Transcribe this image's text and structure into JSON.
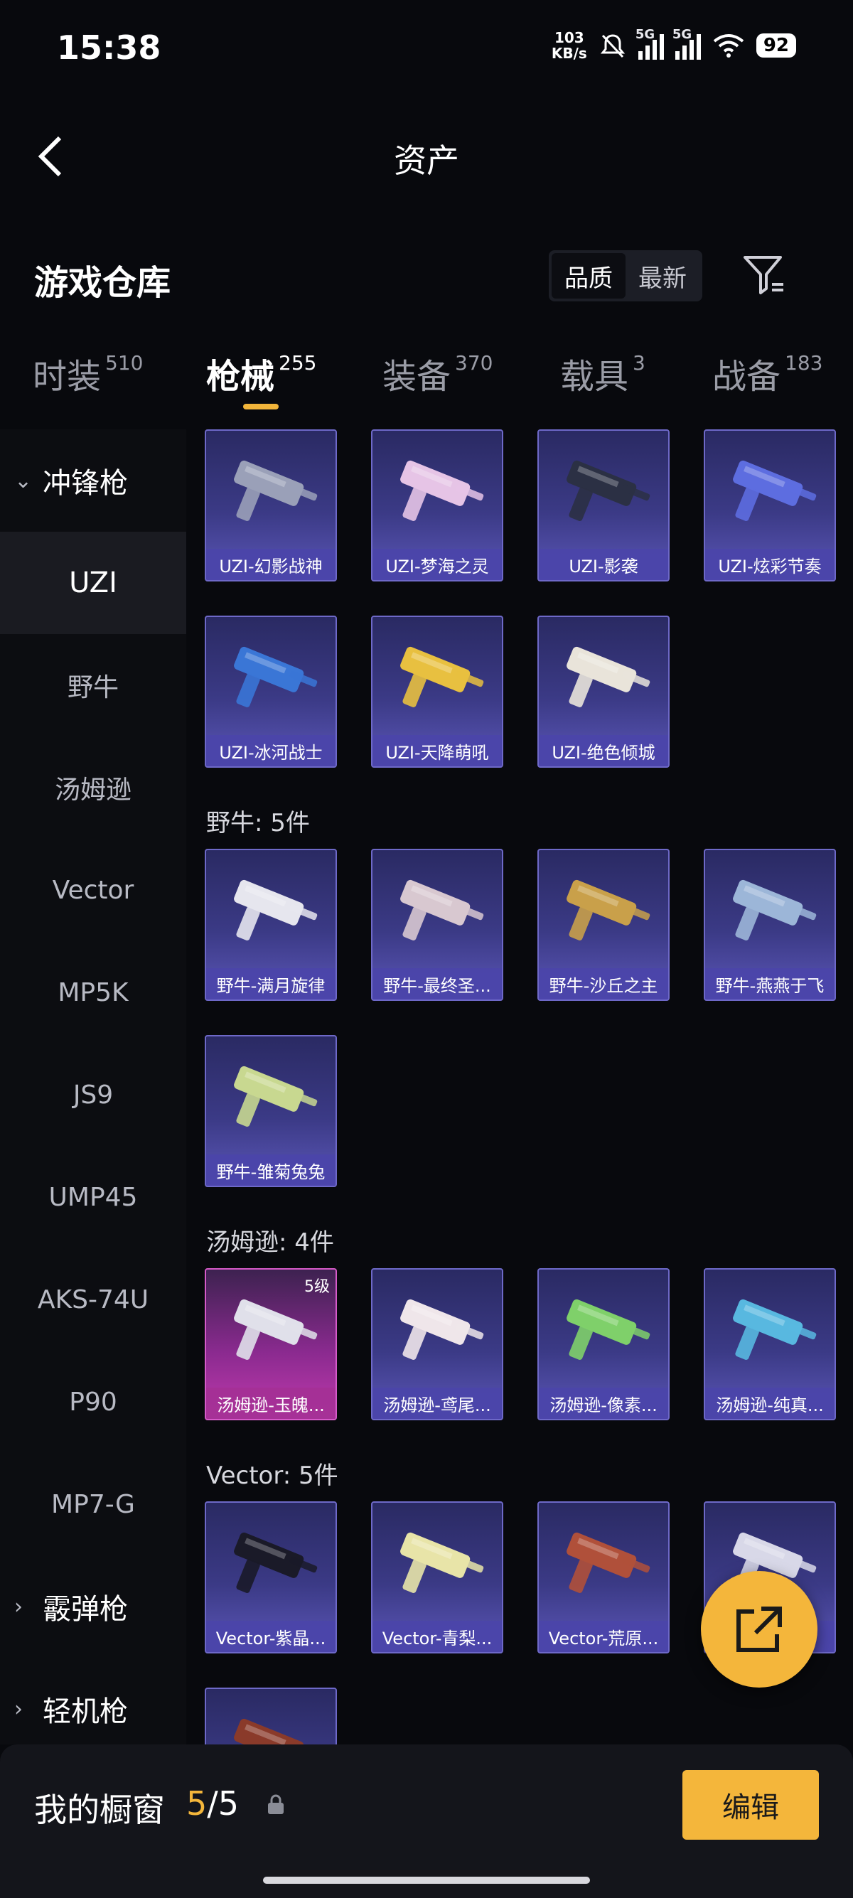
{
  "status": {
    "time": "15:38",
    "net_speed_value": "103",
    "net_speed_unit": "KB/s",
    "signal1_label": "5G",
    "signal2_label": "5G",
    "battery": "92"
  },
  "header": {
    "title": "资产"
  },
  "section": {
    "title": "游戏仓库",
    "sort_options": [
      "品质",
      "最新"
    ],
    "active_sort": "品质"
  },
  "tabs": [
    {
      "label": "时装",
      "count": "510"
    },
    {
      "label": "枪械",
      "count": "255",
      "active": true
    },
    {
      "label": "装备",
      "count": "370"
    },
    {
      "label": "载具",
      "count": "3"
    },
    {
      "label": "战备",
      "count": "183"
    }
  ],
  "sidebar": {
    "groups": [
      {
        "label": "冲锋枪",
        "expanded": true
      },
      {
        "label": "霰弹枪",
        "expanded": false
      },
      {
        "label": "轻机枪",
        "expanded": false
      }
    ],
    "items": [
      "UZI",
      "野牛",
      "汤姆逊",
      "Vector",
      "MP5K",
      "JS9",
      "UMP45",
      "AKS-74U",
      "P90",
      "MP7-G"
    ],
    "active_item": "UZI"
  },
  "groups": [
    {
      "label": "",
      "items": [
        {
          "name": "UZI-幻影战神",
          "color": "#9aa0b8"
        },
        {
          "name": "UZI-梦海之灵",
          "color": "#e6c4e6"
        },
        {
          "name": "UZI-影袭",
          "color": "#2b3044"
        },
        {
          "name": "UZI-炫彩节奏",
          "color": "#5d6de0"
        },
        {
          "name": "UZI-冰河战士",
          "color": "#3a76d6"
        },
        {
          "name": "UZI-天降萌吼",
          "color": "#e8c040"
        },
        {
          "name": "UZI-绝色倾城",
          "color": "#e9e4da"
        }
      ]
    },
    {
      "label": "野牛: 5件",
      "items": [
        {
          "name": "野牛-满月旋律",
          "color": "#e6e6ee"
        },
        {
          "name": "野牛-最终圣...",
          "color": "#d8c8d0"
        },
        {
          "name": "野牛-沙丘之主",
          "color": "#c9a04a"
        },
        {
          "name": "野牛-燕燕于飞",
          "color": "#9cb6d8"
        },
        {
          "name": "野牛-雏菊兔兔",
          "color": "#c8d890"
        }
      ]
    },
    {
      "label": "汤姆逊: 4件",
      "items": [
        {
          "name": "汤姆逊-玉魄...",
          "color": "#e0e0ea",
          "level": "5级",
          "highlight": true
        },
        {
          "name": "汤姆逊-鸢尾...",
          "color": "#efe6ea"
        },
        {
          "name": "汤姆逊-像素...",
          "color": "#7fd06a"
        },
        {
          "name": "汤姆逊-纯真...",
          "color": "#58b8e0"
        }
      ]
    },
    {
      "label": "Vector: 5件",
      "items": [
        {
          "name": "Vector-紫晶...",
          "color": "#1a1a28"
        },
        {
          "name": "Vector-青梨...",
          "color": "#e8e4a8"
        },
        {
          "name": "Vector-荒原...",
          "color": "#b0503a"
        },
        {
          "name": "",
          "color": "#d8d8e8"
        },
        {
          "name": "",
          "color": "#8a3a2a"
        }
      ]
    }
  ],
  "showcase": {
    "label": "我的橱窗",
    "current": "5",
    "total": "5",
    "edit_label": "编辑"
  }
}
